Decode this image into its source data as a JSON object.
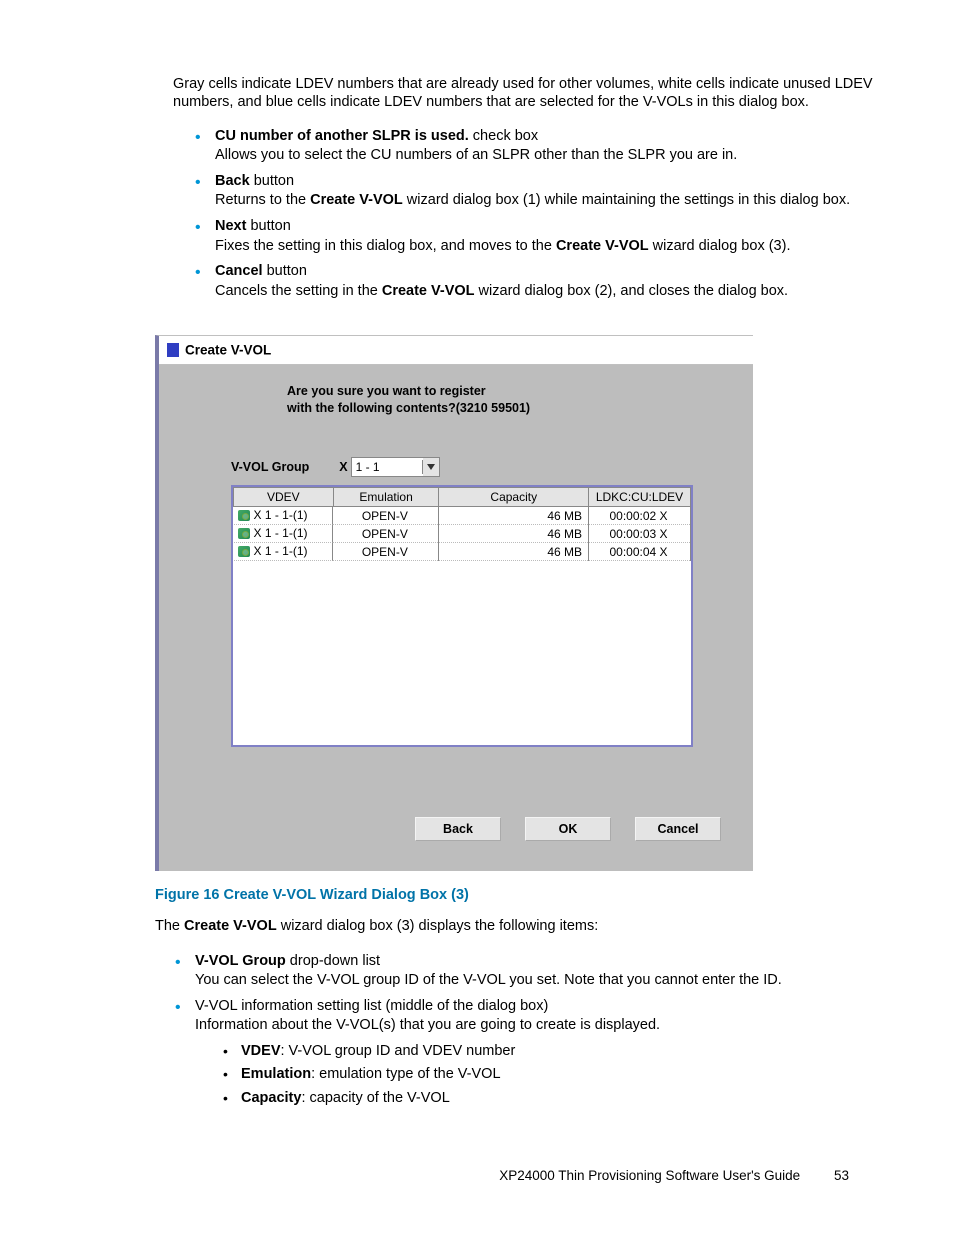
{
  "intro": "Gray cells indicate LDEV numbers that are already used for other volumes, white cells indicate unused LDEV numbers, and blue cells indicate LDEV numbers that are selected for the V-VOLs in this dialog box.",
  "bullets_top": [
    {
      "lead_bold": "CU number of another SLPR is used.",
      "lead_rest": " check box",
      "body": "Allows you to select the CU numbers of an SLPR other than the SLPR you are in."
    },
    {
      "lead_bold": "Back",
      "lead_rest": " button",
      "body_pre": "Returns to the ",
      "body_bold": "Create V-VOL",
      "body_post": " wizard dialog box (1) while maintaining the settings in this dialog box."
    },
    {
      "lead_bold": "Next",
      "lead_rest": " button",
      "body_pre": "Fixes the setting in this dialog box, and moves to the ",
      "body_bold": "Create V-VOL",
      "body_post": " wizard dialog box (3)."
    },
    {
      "lead_bold": "Cancel",
      "lead_rest": " button",
      "body_pre": "Cancels the setting in the ",
      "body_bold": "Create V-VOL",
      "body_post": " wizard dialog box (2), and closes the dialog box."
    }
  ],
  "dialog": {
    "title": "Create V-VOL",
    "prompt_line1": "Are you sure you want to register",
    "prompt_line2": "with the following contents?(3210 59501)",
    "group_label": "V-VOL Group",
    "group_prefix": "X",
    "group_value": "1 - 1",
    "headers": {
      "vdev": "VDEV",
      "emulation": "Emulation",
      "capacity": "Capacity",
      "ldkc": "LDKC:CU:LDEV"
    },
    "rows": [
      {
        "vdev": "X 1 - 1-(1)",
        "emulation": "OPEN-V",
        "capacity": "46 MB",
        "ldkc": "00:00:02 X"
      },
      {
        "vdev": "X 1 - 1-(1)",
        "emulation": "OPEN-V",
        "capacity": "46 MB",
        "ldkc": "00:00:03 X"
      },
      {
        "vdev": "X 1 - 1-(1)",
        "emulation": "OPEN-V",
        "capacity": "46 MB",
        "ldkc": "00:00:04 X"
      }
    ],
    "buttons": {
      "back": "Back",
      "ok": "OK",
      "cancel": "Cancel"
    }
  },
  "caption": "Figure 16 Create V-VOL Wizard Dialog Box (3)",
  "after_caption_pre": "The ",
  "after_caption_bold": "Create V-VOL",
  "after_caption_post": " wizard dialog box (3) displays the following items:",
  "bullets_bottom": [
    {
      "lead_bold": "V-VOL Group",
      "lead_rest": " drop-down list",
      "body": "You can select the V-VOL group ID of the V-VOL you set.  Note that you cannot enter the ID."
    },
    {
      "plain_lead": "V-VOL information setting list (middle of the dialog box)",
      "body": "Information about the V-VOL(s) that you are going to create is displayed.",
      "sub": [
        {
          "b": "VDEV",
          "rest": ": V-VOL group ID and VDEV number"
        },
        {
          "b": "Emulation",
          "rest": ":  emulation type of the V-VOL"
        },
        {
          "b": "Capacity",
          "rest": ":  capacity of the V-VOL"
        }
      ]
    }
  ],
  "footer": {
    "title": "XP24000 Thin Provisioning Software User's Guide",
    "page": "53"
  }
}
